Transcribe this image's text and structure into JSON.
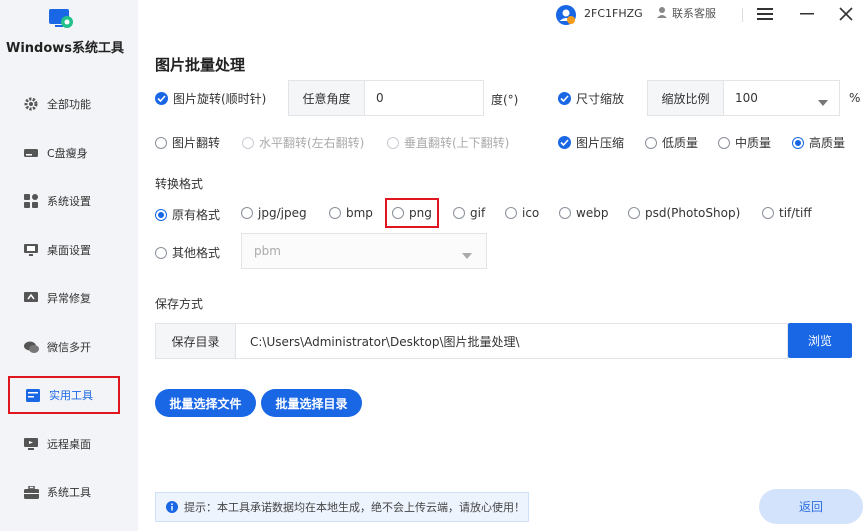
{
  "app": {
    "name": "Windows系统工具"
  },
  "sidebar": {
    "items": [
      {
        "label": "全部功能",
        "icon": "gear-icon"
      },
      {
        "label": "C盘瘦身",
        "icon": "drive-icon"
      },
      {
        "label": "系统设置",
        "icon": "grid-icon"
      },
      {
        "label": "桌面设置",
        "icon": "monitor-icon"
      },
      {
        "label": "异常修复",
        "icon": "wrench-icon"
      },
      {
        "label": "微信多开",
        "icon": "chat-icon"
      },
      {
        "label": "实用工具",
        "icon": "toolbox-icon"
      },
      {
        "label": "远程桌面",
        "icon": "remote-icon"
      },
      {
        "label": "系统工具",
        "icon": "briefcase-icon"
      }
    ],
    "active_index": 6
  },
  "header": {
    "device_id": "2FC1FHZG",
    "service_label": "联系客服"
  },
  "main": {
    "title": "图片批量处理",
    "rotate": {
      "label": "图片旋转(顺时针)",
      "checked": true,
      "angle_label": "任意角度",
      "angle_value": "0",
      "unit": "度(°)"
    },
    "resize": {
      "label": "尺寸缩放",
      "checked": true,
      "scale_label": "缩放比例",
      "scale_value": "100",
      "unit": "%"
    },
    "flip": {
      "label": "图片翻转",
      "horizontal": "水平翻转(左右翻转)",
      "vertical": "垂直翻转(上下翻转)"
    },
    "compress": {
      "label": "图片压缩",
      "checked": true,
      "low": "低质量",
      "mid": "中质量",
      "high": "高质量",
      "selected": "high"
    },
    "format": {
      "section_label": "转换格式",
      "options": [
        "原有格式",
        "jpg/jpeg",
        "bmp",
        "png",
        "gif",
        "ico",
        "webp",
        "psd(PhotoShop)",
        "tif/tiff"
      ],
      "selected": "原有格式",
      "other_label": "其他格式",
      "other_value": "pbm"
    },
    "save": {
      "section_label": "保存方式",
      "dir_label": "保存目录",
      "dir_value": "C:\\Users\\Administrator\\Desktop\\图片批量处理\\",
      "browse_label": "浏览"
    },
    "buttons": {
      "select_files": "批量选择文件",
      "select_dir": "批量选择目录"
    },
    "notice": "提示：本工具承诺数据均在本地生成，绝不会上传云端，请放心使用！",
    "back_label": "返回"
  },
  "colors": {
    "accent": "#1a67e6",
    "highlight": "#e0161e",
    "sidebar_bg": "#f3f4f7"
  }
}
